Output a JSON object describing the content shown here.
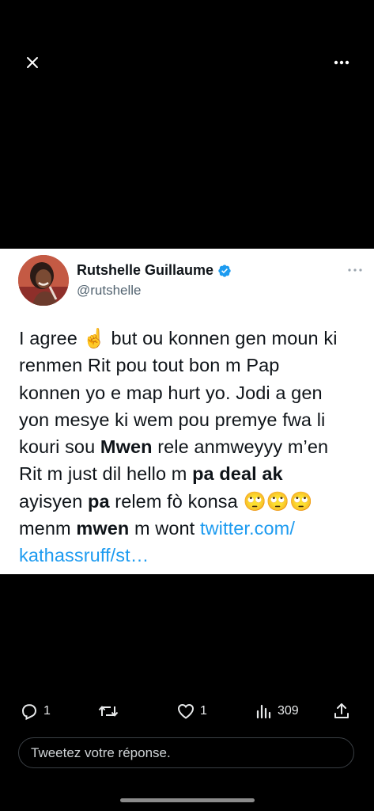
{
  "author": {
    "name": "Rutshelle Guillaume",
    "handle": "@rutshelle"
  },
  "tweet": {
    "lines": [
      [
        {
          "t": "I agree "
        },
        {
          "t": "☝️"
        },
        {
          "t": " but ou konnen gen moun ki"
        }
      ],
      [
        {
          "t": "renmen Rit pou tout bon m Pap"
        }
      ],
      [
        {
          "t": "konnen yo e map hurt yo. Jodi a gen"
        }
      ],
      [
        {
          "t": "yon mesye ki wem pou premye fwa li"
        }
      ],
      [
        {
          "t": "kouri sou "
        },
        {
          "t": "Mwen",
          "b": true
        },
        {
          "t": " rele anmweyyy m’en"
        }
      ],
      [
        {
          "t": "Rit m just dil hello m "
        },
        {
          "t": "pa deal ak",
          "b": true
        }
      ],
      [
        {
          "t": "ayisyen "
        },
        {
          "t": "pa",
          "b": true
        },
        {
          "t": " relem fò konsa "
        },
        {
          "t": "🙄🙄🙄"
        }
      ],
      [
        {
          "t": "menm "
        },
        {
          "t": "mwen",
          "b": true
        },
        {
          "t": " m wont "
        },
        {
          "t": "twitter.com/",
          "link": true
        }
      ],
      [
        {
          "t": "kathassruff/st…",
          "link": true
        }
      ]
    ]
  },
  "actions": {
    "reply_count": "1",
    "retweet_count": "",
    "like_count": "1",
    "views_count": "309"
  },
  "reply_box": {
    "placeholder": "Tweetez votre réponse."
  },
  "icons": {
    "close": "close-icon",
    "more": "more-horizontal-icon",
    "verified": "verified-badge-icon",
    "reply": "reply-icon",
    "retweet": "retweet-icon",
    "like": "heart-icon",
    "views": "views-chart-icon",
    "share": "share-icon"
  },
  "colors": {
    "verified": "#1d9bf0",
    "link": "#1d9bf0",
    "background": "#000000",
    "card": "#ffffff"
  }
}
